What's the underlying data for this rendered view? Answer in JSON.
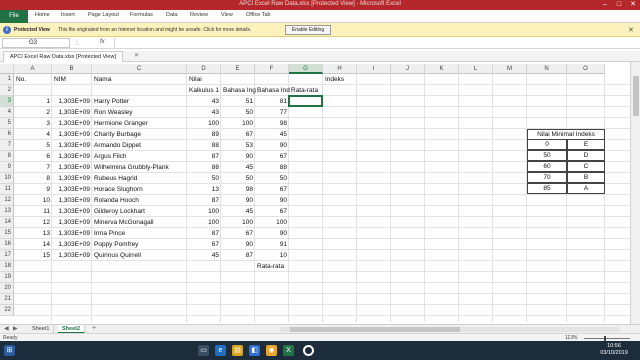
{
  "window": {
    "title": "APCI Excel Raw Data.xlsx  [Protected View] - Microsoft Excel",
    "minimize": "–",
    "maximize": "□",
    "close": "✕"
  },
  "ribbon": {
    "file": "File",
    "tabs": [
      "Home",
      "Insert",
      "Page Layout",
      "Formulas",
      "Data",
      "Review",
      "View",
      "Office Tab"
    ]
  },
  "protected_view": {
    "icon": "shield-icon",
    "label": "Protected View",
    "message": "This file originated from an Internet location and might be unsafe. Click for more details.",
    "button": "Enable Editing",
    "close": "✕"
  },
  "formula_bar": {
    "name_box": "G3",
    "fx": "fx",
    "value": ""
  },
  "document_tab": {
    "name": "APCI Excel Raw Data.xlsx  [Protected View]",
    "close": "✕"
  },
  "columns": [
    "A",
    "B",
    "C",
    "D",
    "E",
    "F",
    "G",
    "H",
    "I",
    "J",
    "K",
    "L",
    "M",
    "N",
    "O"
  ],
  "rows": [
    "1",
    "2",
    "3",
    "4",
    "5",
    "6",
    "7",
    "8",
    "9",
    "10",
    "11",
    "12",
    "13",
    "14",
    "15",
    "16",
    "17",
    "18",
    "19",
    "20",
    "21",
    "22"
  ],
  "selected": {
    "column": "G",
    "row": "3"
  },
  "headers": {
    "a1": "No.",
    "b1": "NIM",
    "c1": "Nama",
    "d1": "Nilai",
    "h1": "Indeks",
    "d2": "Kalkulus 1",
    "e2": "Bahasa Ing",
    "f2": "Bahasa Ind",
    "g2": "Rata-rata",
    "f18": "Rata-rata"
  },
  "students": [
    {
      "no": "1",
      "nim": "1,303E+09",
      "nama": "Harry Potter",
      "d": "43",
      "e": "51",
      "f": "81"
    },
    {
      "no": "2",
      "nim": "1,303E+09",
      "nama": "Ron Weasley",
      "d": "43",
      "e": "50",
      "f": "77"
    },
    {
      "no": "3",
      "nim": "1,303E+09",
      "nama": "Hermione Granger",
      "d": "100",
      "e": "100",
      "f": "98"
    },
    {
      "no": "4",
      "nim": "1,303E+09",
      "nama": "Charity Burbage",
      "d": "89",
      "e": "67",
      "f": "45"
    },
    {
      "no": "5",
      "nim": "1,303E+09",
      "nama": "Armando Dippet",
      "d": "88",
      "e": "53",
      "f": "90"
    },
    {
      "no": "6",
      "nim": "1,303E+09",
      "nama": "Argus Filch",
      "d": "87",
      "e": "90",
      "f": "67"
    },
    {
      "no": "7",
      "nim": "1,303E+09",
      "nama": "Wilhelmina Grubbly-Plank",
      "d": "88",
      "e": "45",
      "f": "88"
    },
    {
      "no": "8",
      "nim": "1,303E+09",
      "nama": "Rubeus Hagrid",
      "d": "50",
      "e": "50",
      "f": "50"
    },
    {
      "no": "9",
      "nim": "1,303E+09",
      "nama": "Horace Slughorn",
      "d": "13",
      "e": "98",
      "f": "67"
    },
    {
      "no": "10",
      "nim": "1,303E+09",
      "nama": "Rolanda Hooch",
      "d": "87",
      "e": "90",
      "f": "90"
    },
    {
      "no": "11",
      "nim": "1,303E+09",
      "nama": "Gilderoy Lockhart",
      "d": "100",
      "e": "45",
      "f": "67"
    },
    {
      "no": "12",
      "nim": "1,303E+09",
      "nama": "Minerva McGonagall",
      "d": "100",
      "e": "100",
      "f": "100"
    },
    {
      "no": "13",
      "nim": "1,303E+09",
      "nama": "Irma Pince",
      "d": "87",
      "e": "67",
      "f": "90"
    },
    {
      "no": "14",
      "nim": "1,303E+09",
      "nama": "Poppy Pomfrey",
      "d": "67",
      "e": "90",
      "f": "91"
    },
    {
      "no": "15",
      "nim": "1,303E+09",
      "nama": "Quirinus Quirrell",
      "d": "45",
      "e": "87",
      "f": "10"
    }
  ],
  "index_table": {
    "header": "Nilai Minimal Indeks",
    "rows": [
      {
        "min": "0",
        "grade": "E"
      },
      {
        "min": "50",
        "grade": "D"
      },
      {
        "min": "60",
        "grade": "C"
      },
      {
        "min": "70",
        "grade": "B"
      },
      {
        "min": "85",
        "grade": "A"
      }
    ]
  },
  "sheets": {
    "tabs": [
      "Sheet1",
      "Sheet2"
    ],
    "active": "Sheet2",
    "add": "+"
  },
  "status": {
    "ready": "Ready",
    "zoom": "113%"
  },
  "taskbar": {
    "time": "10:56",
    "date": "03/10/2019"
  }
}
